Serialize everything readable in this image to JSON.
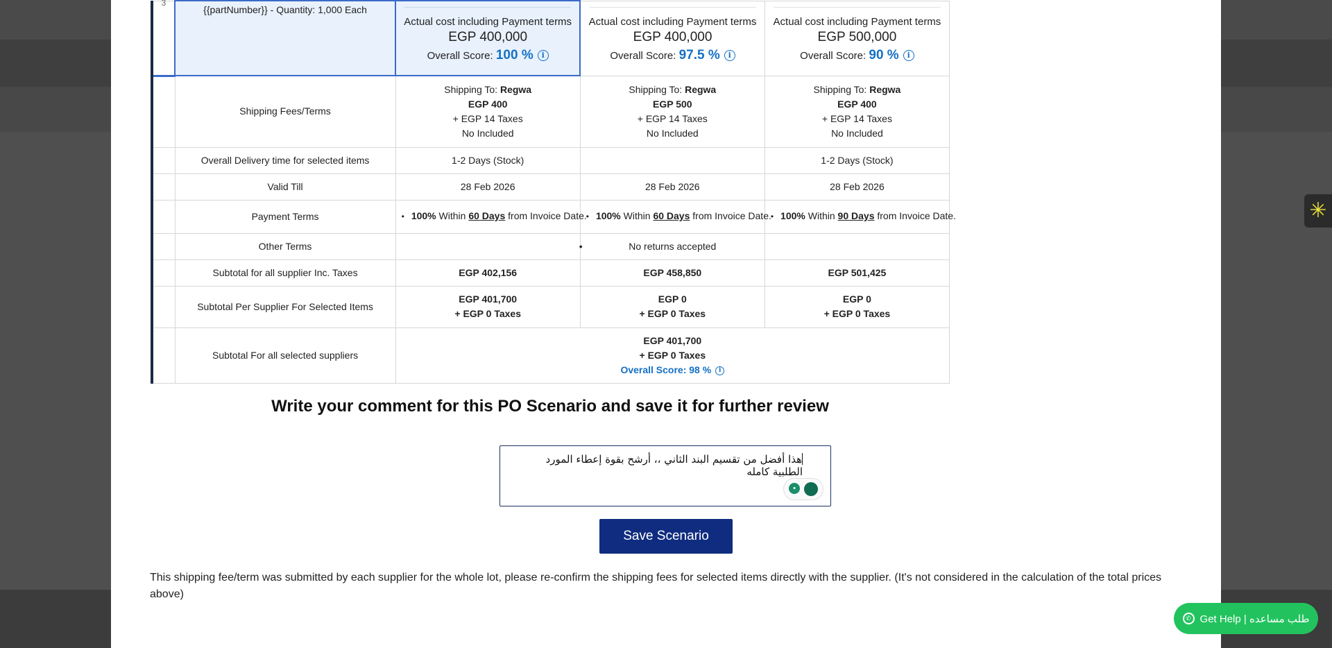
{
  "top_row": {
    "first_col_number": "3",
    "item_desc": "{{partNumber}} - Quantity: 1,000 Each",
    "suppliers": [
      {
        "cost_label": "Actual cost including Payment terms",
        "cost_value": "EGP 400,000",
        "score_label": "Overall Score:",
        "score_value": "100 %"
      },
      {
        "cost_label": "Actual cost including Payment terms",
        "cost_value": "EGP 400,000",
        "score_label": "Overall Score:",
        "score_value": "97.5 %"
      },
      {
        "cost_label": "Actual cost including Payment terms",
        "cost_value": "EGP 500,000",
        "score_label": "Overall Score:",
        "score_value": "90 %"
      }
    ]
  },
  "shipping": {
    "label": "Shipping Fees/Terms",
    "cells": [
      {
        "to_label": "Shipping To:",
        "to_value": "Regwa",
        "fee": "EGP 400",
        "tax": "+ EGP 14 Taxes",
        "incl": "No Included"
      },
      {
        "to_label": "Shipping To:",
        "to_value": "Regwa",
        "fee": "EGP 500",
        "tax": "+ EGP 14 Taxes",
        "incl": "No Included"
      },
      {
        "to_label": "Shipping To:",
        "to_value": "Regwa",
        "fee": "EGP 400",
        "tax": "+ EGP 14 Taxes",
        "incl": "No Included"
      }
    ]
  },
  "delivery": {
    "label": "Overall Delivery time for selected items",
    "values": [
      "1-2 Days (Stock)",
      "",
      "1-2 Days (Stock)"
    ]
  },
  "valid_till": {
    "label": "Valid Till",
    "values": [
      "28 Feb 2026",
      "28 Feb 2026",
      "28 Feb 2026"
    ]
  },
  "payment_terms": {
    "label": "Payment Terms",
    "cells": [
      {
        "percent": "100%",
        "within": "Within",
        "days": "60 Days",
        "rest": "from Invoice Date."
      },
      {
        "percent": "100%",
        "within": "Within",
        "days": "60 Days",
        "rest": "from Invoice Date."
      },
      {
        "percent": "100%",
        "within": "Within",
        "days": "90 Days",
        "rest": "from Invoice Date."
      }
    ]
  },
  "other_terms": {
    "label": "Other Terms",
    "values": [
      "",
      "No returns accepted",
      ""
    ]
  },
  "subtotal_all": {
    "label": "Subtotal for all supplier Inc. Taxes",
    "values": [
      "EGP 402,156",
      "EGP 458,850",
      "EGP 501,425"
    ]
  },
  "subtotal_selected": {
    "label": "Subtotal Per Supplier For Selected Items",
    "cells": [
      {
        "amount": "EGP 401,700",
        "tax": "+ EGP 0 Taxes"
      },
      {
        "amount": "EGP 0",
        "tax": "+ EGP 0 Taxes"
      },
      {
        "amount": "EGP 0",
        "tax": "+ EGP 0 Taxes"
      }
    ]
  },
  "subtotal_suppliers": {
    "label": "Subtotal For all selected suppliers",
    "amount": "EGP 401,700",
    "tax": "+ EGP 0 Taxes",
    "score": "Overall Score: 98 %"
  },
  "comment_section": {
    "title": "Write your comment for this PO Scenario and save it for further review",
    "comment_text": "هذا أفضل من تقسيم البند الثاني ،، أرشح بقوة إعطاء المورد الطلبية كامله",
    "save_label": "Save Scenario"
  },
  "note": "This shipping fee/term was submitted by each supplier for the whole lot, please re-confirm the shipping fees for selected items directly with the supplier. (It's not considered in the calculation of the total prices above)",
  "help_button": {
    "label": "Get Help | طلب مساعده"
  },
  "colors": {
    "accent": "#1470c6",
    "primary_button": "#0f2c80",
    "help_green": "#22c35e",
    "selected_bg": "#e8f1fc"
  }
}
